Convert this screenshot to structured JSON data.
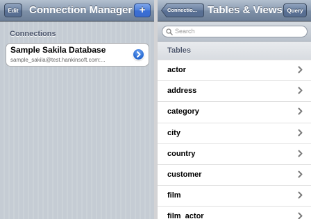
{
  "left": {
    "nav": {
      "edit_label": "Edit",
      "title": "Connection Manager",
      "add_label": "+"
    },
    "section_title": "Connections",
    "connection": {
      "name": "Sample Sakila Database",
      "detail": "sample_sakila@test.hankinsoft.com:..."
    }
  },
  "right": {
    "nav": {
      "back_label": "Connectio...",
      "title": "Tables & Views",
      "query_label": "Query"
    },
    "search": {
      "placeholder": "Search"
    },
    "section_title": "Tables",
    "tables": [
      "actor",
      "address",
      "category",
      "city",
      "country",
      "customer",
      "film",
      "film_actor"
    ]
  },
  "colors": {
    "accent": "#3a6fd6",
    "navbar": "#7f91a8"
  },
  "icons": {
    "search": "search-icon",
    "back": "back-arrow-icon",
    "disclosure": "disclosure-button-icon",
    "chevron": "chevron-right-icon"
  }
}
